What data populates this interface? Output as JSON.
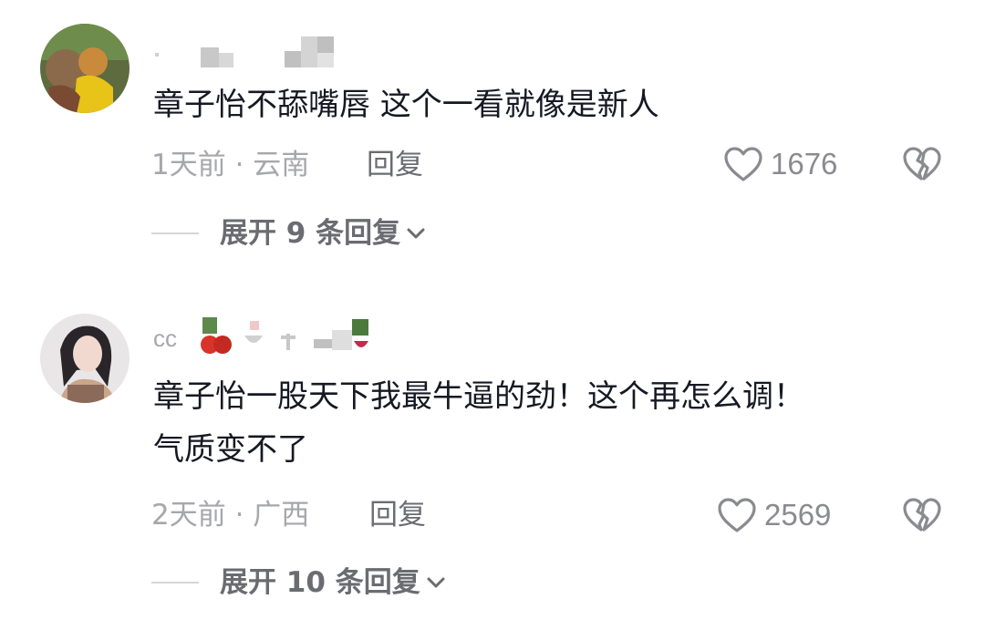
{
  "comments": [
    {
      "text": "章子怡不舔嘴唇 这个一看就像是新人",
      "time_location": "1天前 · 云南",
      "reply_label": "回复",
      "likes": "1676",
      "expand_label": "展开 9 条回复"
    },
    {
      "text": "章子怡一股天下我最牛逼的劲！这个再怎么调！\n气质变不了",
      "time_location": "2天前 · 广西",
      "reply_label": "回复",
      "likes": "2569",
      "expand_label": "展开 10 条回复",
      "username_visible_prefix": "cc"
    }
  ],
  "icons": {
    "like": "heart-outline-icon",
    "dislike": "broken-heart-icon",
    "expand": "chevron-down-icon"
  },
  "colors": {
    "text": "#161823",
    "meta": "#a6a7ab",
    "secondary": "#6b6c71",
    "icon": "#8a8b90"
  }
}
